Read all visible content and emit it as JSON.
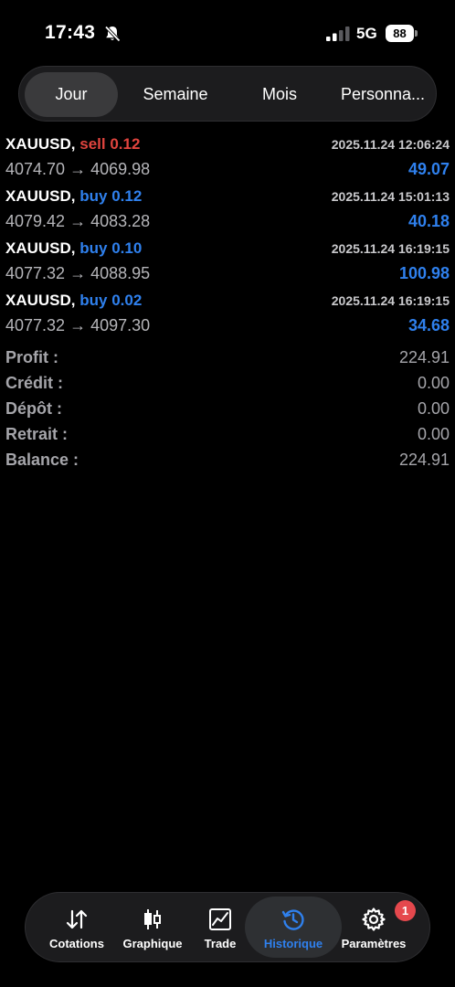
{
  "status_bar": {
    "time": "17:43",
    "network": "5G",
    "battery": "88",
    "icons": [
      "bell-slash-icon",
      "signal-icon",
      "battery-icon"
    ]
  },
  "period_tabs": {
    "items": [
      {
        "label": "Jour",
        "active": true
      },
      {
        "label": "Semaine",
        "active": false
      },
      {
        "label": "Mois",
        "active": false
      },
      {
        "label": "Personna...",
        "active": false
      }
    ]
  },
  "trades": [
    {
      "symbol": "XAUUSD,",
      "side": "sell 0.12",
      "side_type": "sell",
      "time": "2025.11.24 12:06:24",
      "prices": "4074.70 → 4069.98",
      "profit": "49.07"
    },
    {
      "symbol": "XAUUSD,",
      "side": "buy 0.12",
      "side_type": "buy",
      "time": "2025.11.24 15:01:13",
      "prices": "4079.42 → 4083.28",
      "profit": "40.18"
    },
    {
      "symbol": "XAUUSD,",
      "side": "buy 0.10",
      "side_type": "buy",
      "time": "2025.11.24 16:19:15",
      "prices": "4077.32 → 4088.95",
      "profit": "100.98"
    },
    {
      "symbol": "XAUUSD,",
      "side": "buy 0.02",
      "side_type": "buy",
      "time": "2025.11.24 16:19:15",
      "prices": "4077.32 → 4097.30",
      "profit": "34.68"
    }
  ],
  "summary": [
    {
      "label": "Profit :",
      "value": "224.91"
    },
    {
      "label": "Crédit :",
      "value": "0.00"
    },
    {
      "label": "Dépôt :",
      "value": "0.00"
    },
    {
      "label": "Retrait :",
      "value": "0.00"
    },
    {
      "label": "Balance :",
      "value": "224.91"
    }
  ],
  "bottom_nav": {
    "items": [
      {
        "label": "Cotations",
        "icon": "arrows-updown-icon",
        "active": false
      },
      {
        "label": "Graphique",
        "icon": "candlestick-icon",
        "active": false
      },
      {
        "label": "Trade",
        "icon": "line-chart-icon",
        "active": false
      },
      {
        "label": "Historique",
        "icon": "history-icon",
        "active": true
      },
      {
        "label": "Paramètres",
        "icon": "gear-icon",
        "active": false,
        "badge": "1"
      }
    ]
  },
  "colors": {
    "accent": "#2f80ed",
    "sell": "#e0443e",
    "badge": "#e5484d",
    "background": "#000000"
  }
}
